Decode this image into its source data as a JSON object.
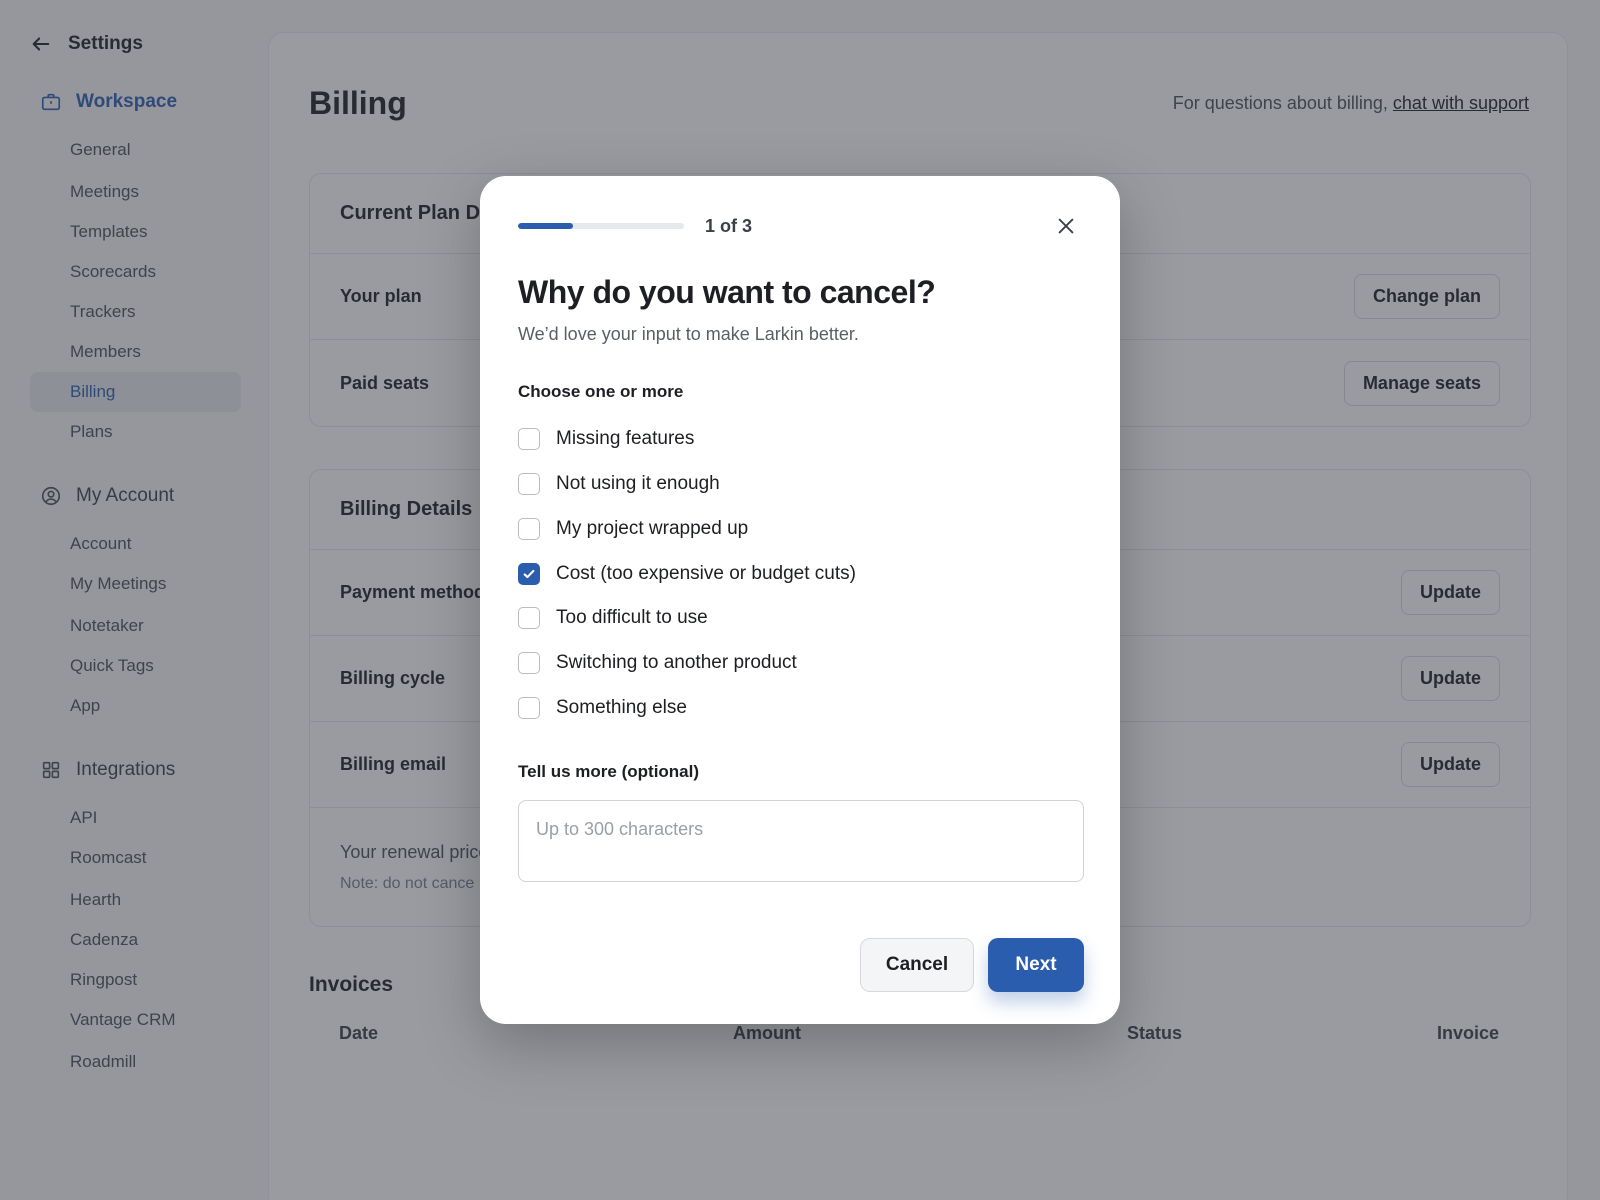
{
  "sidebar": {
    "back_title": "Settings",
    "sections": [
      {
        "label": "Workspace",
        "icon": "briefcase-icon",
        "active": true,
        "items": [
          "General",
          "Meetings",
          "Templates",
          "Scorecards",
          "Trackers",
          "Members",
          "Billing",
          "Plans"
        ]
      },
      {
        "label": "My Account",
        "icon": "user-circle-icon",
        "active": false,
        "items": [
          "Account",
          "My Meetings",
          "Notetaker",
          "Quick Tags",
          "App"
        ]
      },
      {
        "label": "Integrations",
        "icon": "grid-icon",
        "active": false,
        "items": [
          "API",
          "Roomcast",
          "Hearth",
          "Cadenza",
          "Ringpost",
          "Vantage CRM",
          "Roadmill"
        ]
      }
    ],
    "selected_item": "Billing"
  },
  "main": {
    "title": "Billing",
    "support_prefix": "For questions about billing,",
    "support_link": "chat with support",
    "plan_card": {
      "title": "Current Plan De",
      "rows": [
        {
          "label": "Your plan",
          "button": "Change plan"
        },
        {
          "label": "Paid seats",
          "button": "Manage seats"
        }
      ]
    },
    "billing_card": {
      "title": "Billing Details",
      "rows": [
        {
          "label": "Payment method",
          "button": "Update"
        },
        {
          "label": "Billing cycle",
          "button": "Update"
        },
        {
          "label": "Billing email",
          "button": "Update"
        }
      ],
      "renewal_text": "Your renewal price",
      "renewal_note": "Note: do not cance"
    },
    "invoices": {
      "title": "Invoices",
      "columns": [
        "Date",
        "Amount",
        "Status",
        "Invoice"
      ]
    }
  },
  "modal": {
    "step": "1 of 3",
    "progress": 0.33,
    "title": "Why do you want to cancel?",
    "subtitle": "We’d love your input to make Larkin better.",
    "choose_label": "Choose one or more",
    "options": [
      {
        "label": "Missing features",
        "checked": false
      },
      {
        "label": "Not using it enough",
        "checked": false
      },
      {
        "label": "My project wrapped up",
        "checked": false
      },
      {
        "label": "Cost (too expensive or budget cuts)",
        "checked": true
      },
      {
        "label": "Too difficult to use",
        "checked": false
      },
      {
        "label": "Switching to another product",
        "checked": false
      },
      {
        "label": "Something else",
        "checked": false
      }
    ],
    "more_label": "Tell us more (optional)",
    "textarea_placeholder": "Up to 300 characters",
    "textarea_value": "",
    "cancel_label": "Cancel",
    "next_label": "Next"
  },
  "colors": {
    "accent": "#2a5dae",
    "overlay": "#343842"
  }
}
